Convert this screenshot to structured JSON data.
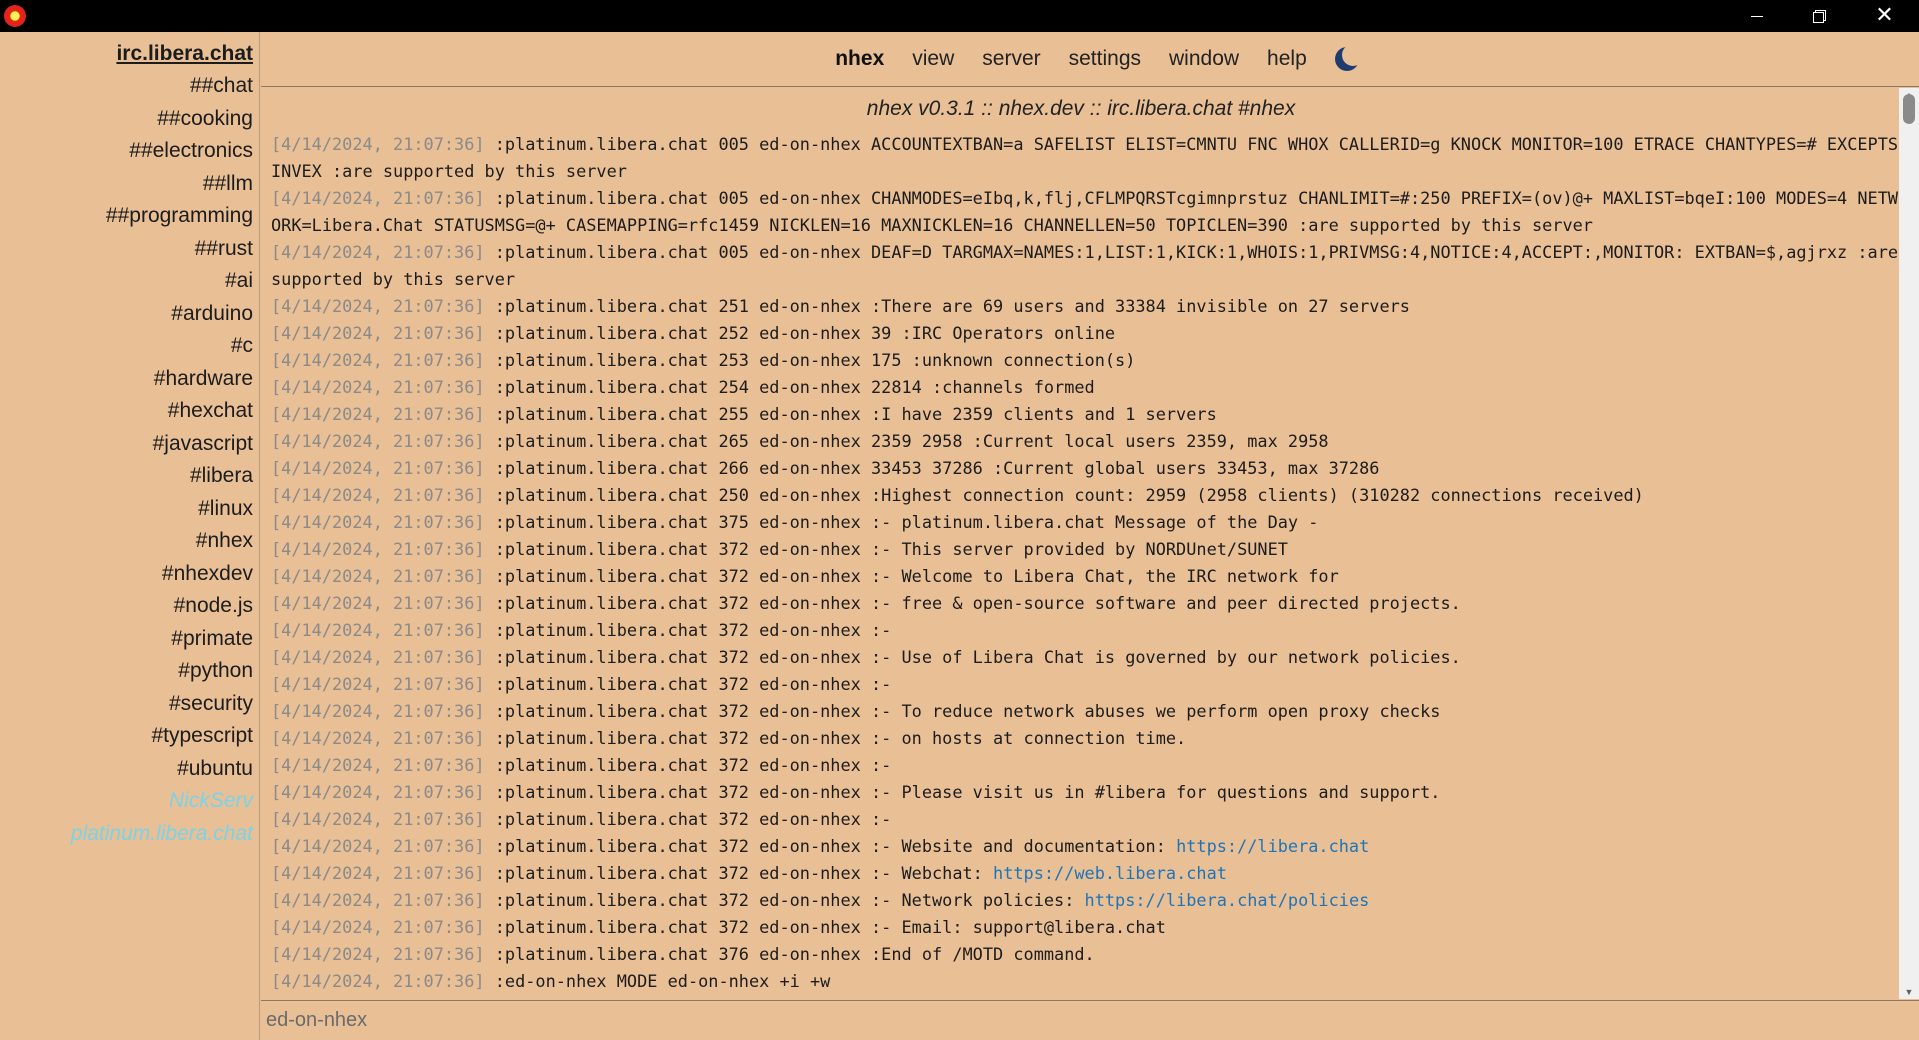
{
  "window": {
    "icon": "app-sun-icon",
    "controls": {
      "minimize": "minimize-icon",
      "maximize": "restore-icon",
      "close": "close-icon"
    }
  },
  "sidebar": {
    "server": "irc.libera.chat",
    "channels": [
      "##chat",
      "##cooking",
      "##electronics",
      "##llm",
      "##programming",
      "##rust",
      "#ai",
      "#arduino",
      "#c",
      "#hardware",
      "#hexchat",
      "#javascript",
      "#libera",
      "#linux",
      "#nhex",
      "#nhexdev",
      "#node.js",
      "#primate",
      "#python",
      "#security",
      "#typescript",
      "#ubuntu"
    ],
    "queries": [
      "NickServ",
      "platinum.libera.chat"
    ]
  },
  "menu": {
    "brand": "nhex",
    "items": [
      "view",
      "server",
      "settings",
      "window",
      "help"
    ],
    "theme_icon": "moon-icon"
  },
  "channel_header": "nhex v0.3.1 :: nhex.dev :: irc.libera.chat #nhex",
  "log": [
    {
      "ts": "[4/14/2024, 21:07:36]",
      "text": ":platinum.libera.chat 005 ed-on-nhex ACCOUNTEXTBAN=a SAFELIST ELIST=CMNTU FNC WHOX CALLERID=g KNOCK MONITOR=100 ETRACE CHANTYPES=# EXCEPTS INVEX :are supported by this server"
    },
    {
      "ts": "[4/14/2024, 21:07:36]",
      "text": ":platinum.libera.chat 005 ed-on-nhex CHANMODES=eIbq,k,flj,CFLMPQRSTcgimnprstuz CHANLIMIT=#:250 PREFIX=(ov)@+ MAXLIST=bqeI:100 MODES=4 NETWORK=Libera.Chat STATUSMSG=@+ CASEMAPPING=rfc1459 NICKLEN=16 MAXNICKLEN=16 CHANNELLEN=50 TOPICLEN=390 :are supported by this server"
    },
    {
      "ts": "[4/14/2024, 21:07:36]",
      "text": ":platinum.libera.chat 005 ed-on-nhex DEAF=D TARGMAX=NAMES:1,LIST:1,KICK:1,WHOIS:1,PRIVMSG:4,NOTICE:4,ACCEPT:,MONITOR: EXTBAN=$,agjrxz :are supported by this server"
    },
    {
      "ts": "[4/14/2024, 21:07:36]",
      "text": ":platinum.libera.chat 251 ed-on-nhex :There are 69 users and 33384 invisible on 27 servers"
    },
    {
      "ts": "[4/14/2024, 21:07:36]",
      "text": ":platinum.libera.chat 252 ed-on-nhex 39 :IRC Operators online"
    },
    {
      "ts": "[4/14/2024, 21:07:36]",
      "text": ":platinum.libera.chat 253 ed-on-nhex 175 :unknown connection(s)"
    },
    {
      "ts": "[4/14/2024, 21:07:36]",
      "text": ":platinum.libera.chat 254 ed-on-nhex 22814 :channels formed"
    },
    {
      "ts": "[4/14/2024, 21:07:36]",
      "text": ":platinum.libera.chat 255 ed-on-nhex :I have 2359 clients and 1 servers"
    },
    {
      "ts": "[4/14/2024, 21:07:36]",
      "text": ":platinum.libera.chat 265 ed-on-nhex 2359 2958 :Current local users 2359, max 2958"
    },
    {
      "ts": "[4/14/2024, 21:07:36]",
      "text": ":platinum.libera.chat 266 ed-on-nhex 33453 37286 :Current global users 33453, max 37286"
    },
    {
      "ts": "[4/14/2024, 21:07:36]",
      "text": ":platinum.libera.chat 250 ed-on-nhex :Highest connection count: 2959 (2958 clients) (310282 connections received)"
    },
    {
      "ts": "[4/14/2024, 21:07:36]",
      "text": ":platinum.libera.chat 375 ed-on-nhex :- platinum.libera.chat Message of the Day -"
    },
    {
      "ts": "[4/14/2024, 21:07:36]",
      "text": ":platinum.libera.chat 372 ed-on-nhex :- This server provided by NORDUnet/SUNET"
    },
    {
      "ts": "[4/14/2024, 21:07:36]",
      "text": ":platinum.libera.chat 372 ed-on-nhex :- Welcome to Libera Chat, the IRC network for"
    },
    {
      "ts": "[4/14/2024, 21:07:36]",
      "text": ":platinum.libera.chat 372 ed-on-nhex :- free & open-source software and peer directed projects."
    },
    {
      "ts": "[4/14/2024, 21:07:36]",
      "text": ":platinum.libera.chat 372 ed-on-nhex :-"
    },
    {
      "ts": "[4/14/2024, 21:07:36]",
      "text": ":platinum.libera.chat 372 ed-on-nhex :- Use of Libera Chat is governed by our network policies."
    },
    {
      "ts": "[4/14/2024, 21:07:36]",
      "text": ":platinum.libera.chat 372 ed-on-nhex :-"
    },
    {
      "ts": "[4/14/2024, 21:07:36]",
      "text": ":platinum.libera.chat 372 ed-on-nhex :- To reduce network abuses we perform open proxy checks"
    },
    {
      "ts": "[4/14/2024, 21:07:36]",
      "text": ":platinum.libera.chat 372 ed-on-nhex :- on hosts at connection time."
    },
    {
      "ts": "[4/14/2024, 21:07:36]",
      "text": ":platinum.libera.chat 372 ed-on-nhex :-"
    },
    {
      "ts": "[4/14/2024, 21:07:36]",
      "text": ":platinum.libera.chat 372 ed-on-nhex :- Please visit us in #libera for questions and support."
    },
    {
      "ts": "[4/14/2024, 21:07:36]",
      "text": ":platinum.libera.chat 372 ed-on-nhex :-"
    },
    {
      "ts": "[4/14/2024, 21:07:36]",
      "text": ":platinum.libera.chat 372 ed-on-nhex :- Website and documentation: ",
      "link": "https://libera.chat"
    },
    {
      "ts": "[4/14/2024, 21:07:36]",
      "text": ":platinum.libera.chat 372 ed-on-nhex :- Webchat: ",
      "link": "https://web.libera.chat"
    },
    {
      "ts": "[4/14/2024, 21:07:36]",
      "text": ":platinum.libera.chat 372 ed-on-nhex :- Network policies: ",
      "link": "https://libera.chat/policies"
    },
    {
      "ts": "[4/14/2024, 21:07:36]",
      "text": ":platinum.libera.chat 372 ed-on-nhex :- Email: support@libera.chat"
    },
    {
      "ts": "[4/14/2024, 21:07:36]",
      "text": ":platinum.libera.chat 376 ed-on-nhex :End of /MOTD command."
    },
    {
      "ts": "[4/14/2024, 21:07:36]",
      "text": ":ed-on-nhex MODE ed-on-nhex +i +w"
    }
  ],
  "input": {
    "placeholder": "ed-on-nhex",
    "value": ""
  },
  "colors": {
    "background": "#e9bf96",
    "timestamp": "#8a8a8a",
    "link": "#1f74b8",
    "query": "#7ad3e8"
  }
}
